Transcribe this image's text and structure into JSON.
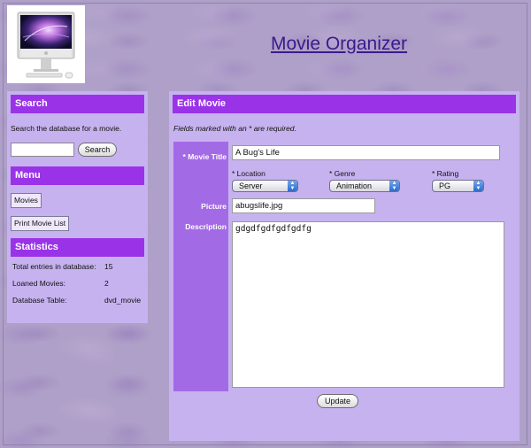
{
  "header": {
    "site_title": "Movie Organizer"
  },
  "sidebar": {
    "search": {
      "heading": "Search",
      "description": "Search the database for a movie.",
      "input_value": "",
      "button_label": "Search"
    },
    "menu": {
      "heading": "Menu",
      "items": [
        "Movies",
        "Print Movie List"
      ]
    },
    "statistics": {
      "heading": "Statistics",
      "rows": [
        {
          "label": "Total entries in database:",
          "value": "15"
        },
        {
          "label": "Loaned Movies:",
          "value": "2"
        },
        {
          "label": "Database Table:",
          "value": "dvd_movie"
        }
      ]
    }
  },
  "edit": {
    "heading": "Edit Movie",
    "required_note": "Fields marked with an * are required.",
    "title": {
      "label": "* Movie Title",
      "value": "A Bug's Life"
    },
    "location": {
      "label": "* Location",
      "value": "Server"
    },
    "genre": {
      "label": "* Genre",
      "value": "Animation"
    },
    "rating": {
      "label": "* Rating",
      "value": "PG"
    },
    "picture": {
      "label": "Picture",
      "value": "abugslife.jpg"
    },
    "description": {
      "label": "Description",
      "value": "gdgdfgdfgdfgdfg"
    },
    "submit_label": "Update"
  },
  "colors": {
    "heading_bar": "#9a33e8",
    "panel": "#c6b2ef",
    "label_column": "#a36ae6",
    "title_link": "#3b1a8c"
  },
  "icons": {
    "logo": "imac-computer-logo",
    "select_arrows": "up-down-arrows-icon"
  }
}
